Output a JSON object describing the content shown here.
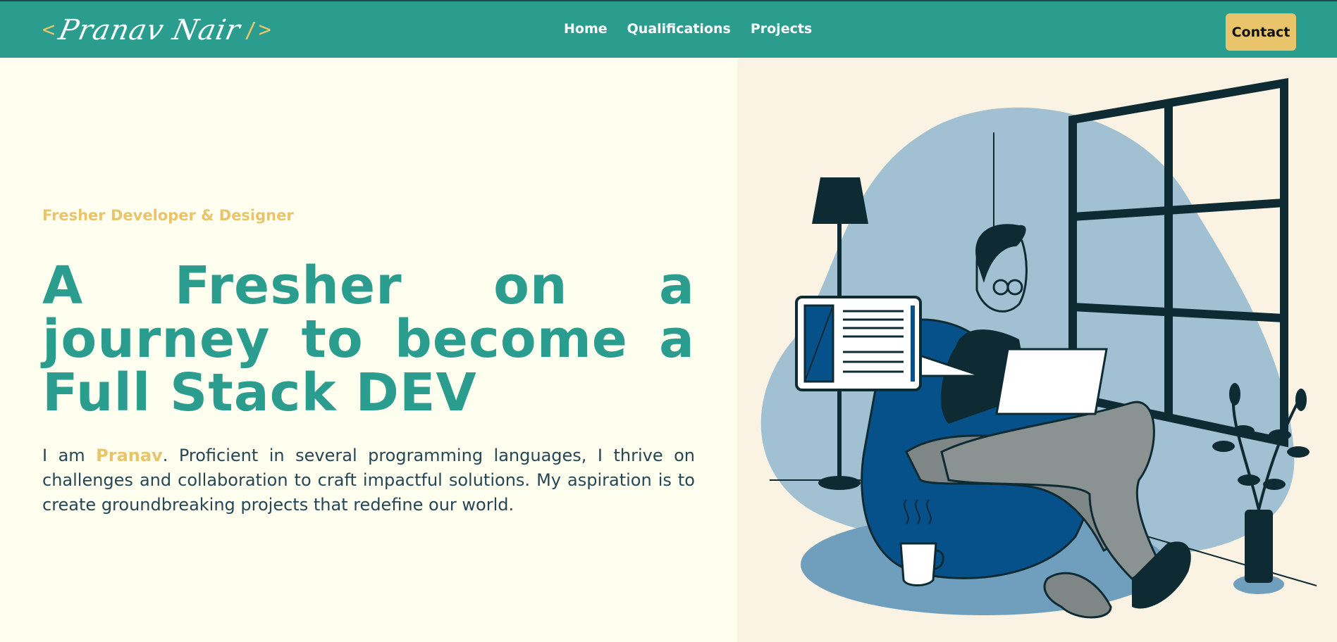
{
  "header": {
    "logo": {
      "open": "<",
      "name": "Pranav Nair",
      "slash": "/",
      "close": ">"
    },
    "nav": [
      "Home",
      "Qualifications",
      "Projects"
    ],
    "contact_label": "Contact"
  },
  "hero": {
    "subtitle": "Fresher Developer & Designer",
    "headline": "A Fresher on a journey to become a Full Stack DEV",
    "intro_prefix": "I am ",
    "intro_name": "Pranav",
    "intro_suffix": ". Proficient in several programming languages, I thrive on challenges and collaboration to craft impactful solutions. My aspiration is to create groundbreaking projects that redefine our world."
  },
  "colors": {
    "primary": "#2a9d8f",
    "accent": "#e9c46a",
    "dark": "#264653",
    "page_bg": "#fffff0",
    "illustration_bg": "#faf3e3"
  },
  "illustration": {
    "subject": "developer-on-beanbag-with-laptop-illustration"
  }
}
